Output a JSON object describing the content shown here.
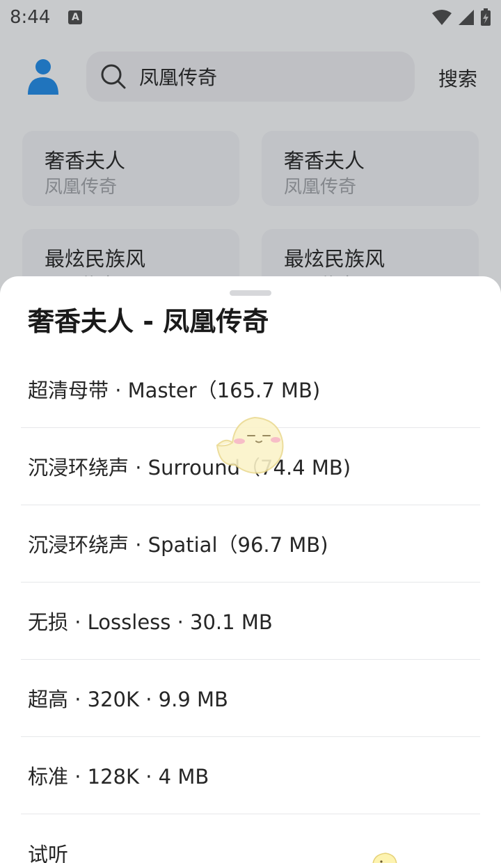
{
  "status": {
    "time": "8:44",
    "badge": "A"
  },
  "header": {
    "search_value": "凤凰传奇",
    "search_button": "搜索"
  },
  "results": [
    {
      "title": "奢香夫人",
      "artist": "凤凰传奇"
    },
    {
      "title": "奢香夫人",
      "artist": "凤凰传奇"
    },
    {
      "title": "最炫民族风",
      "artist": "凤凰传奇"
    },
    {
      "title": "最炫民族风",
      "artist": "凤凰传奇"
    }
  ],
  "sheet": {
    "title": "奢香夫人 - 凤凰传奇",
    "options": [
      "超清母带 · Master（165.7 MB)",
      "沉浸环绕声 · Surround（74.4 MB)",
      "沉浸环绕声 · Spatial（96.7 MB)",
      "无损 · Lossless · 30.1 MB",
      "超高 · 320K · 9.9 MB",
      "标准 · 128K · 4 MB",
      "试听"
    ]
  },
  "colors": {
    "accent": "#1e88e5",
    "scrim": "#282c34",
    "sheet_bg": "#ffffff"
  },
  "icons": [
    "user-avatar-icon",
    "search-icon",
    "wifi-icon",
    "cellular-signal-icon",
    "battery-icon",
    "mascot-icon"
  ]
}
